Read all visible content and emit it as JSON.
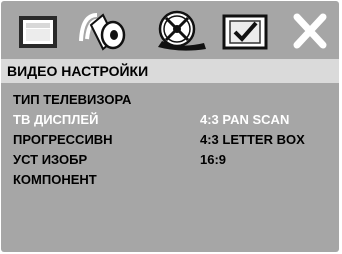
{
  "toolbar": {
    "icons": [
      {
        "name": "general-settings-icon"
      },
      {
        "name": "audio-settings-icon"
      },
      {
        "name": "video-settings-icon"
      },
      {
        "name": "preferences-icon"
      },
      {
        "name": "exit-icon"
      }
    ]
  },
  "page": {
    "title": "ВИДЕО НАСТРОЙКИ"
  },
  "menu": {
    "items": [
      {
        "label": "ТИП ТЕЛЕВИЗОРА"
      },
      {
        "label": "ТВ ДИСПЛЕЙ",
        "active": true
      },
      {
        "label": "ПРОГРЕССИВН"
      },
      {
        "label": "УСТ ИЗОБР"
      },
      {
        "label": "КОМПОНЕНТ"
      }
    ]
  },
  "submenu": {
    "options": [
      {
        "label": "4:3 PAN SCAN",
        "selected": true
      },
      {
        "label": "4:3 LETTER BOX"
      },
      {
        "label": "16:9"
      }
    ]
  },
  "colors": {
    "panel": "#a6a6a6",
    "header_bar": "#dadada",
    "text": "#000000",
    "highlight_text": "#ffffff"
  }
}
